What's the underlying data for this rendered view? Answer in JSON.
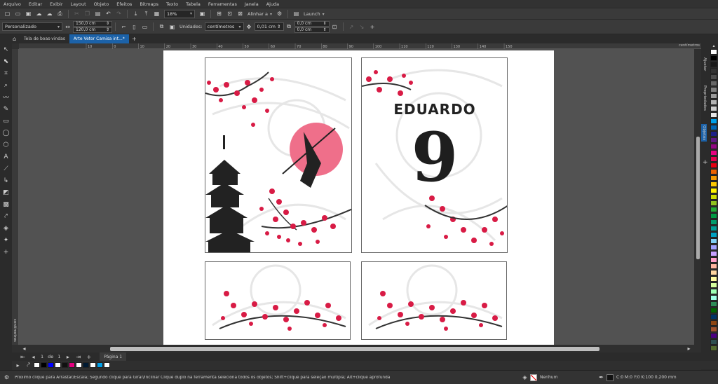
{
  "menu": [
    "Arquivo",
    "Editar",
    "Exibir",
    "Layout",
    "Objeto",
    "Efeitos",
    "Bitmaps",
    "Texto",
    "Tabela",
    "Ferramentas",
    "Janela",
    "Ajuda"
  ],
  "toolbar": {
    "zoom": "18%",
    "align_label": "Alinhar a",
    "launch_label": "Launch"
  },
  "propbar": {
    "preset": "Personalizado",
    "width": "150,0 cm",
    "height": "120,0 cm",
    "units_label": "Unidades:",
    "units": "centímetros",
    "nudge": "0,01 cm",
    "dup_x": "0,0 cm",
    "dup_y": "0,0 cm"
  },
  "tabs": [
    {
      "label": "Tela de boas-vindas"
    },
    {
      "label": "Arte Vetor Camisa int...*"
    }
  ],
  "ruler": {
    "ticks": [
      "10",
      "0",
      "10",
      "20",
      "30",
      "40",
      "50",
      "60",
      "70",
      "80",
      "90",
      "100",
      "110",
      "120",
      "130",
      "140",
      "150"
    ],
    "unit": "centímetros",
    "left_unit": "centímetros"
  },
  "artwork": {
    "name_text": "EDUARDO",
    "big_letter": "9"
  },
  "pagenav": {
    "current": "1",
    "of": "de",
    "total": "1",
    "page_label": "Página 1"
  },
  "docker_tabs": [
    "Ajustar",
    "Propriedades",
    "Objetos"
  ],
  "status": {
    "hint": "Próximo clique para Arrastar/Escala; Segundo clique para Girar/Inclinar Clique duplo na ferramenta seleciona todos os objetos; Shift+clique para seleção múltipla; Alt+clique aprofunda",
    "fill_label": "Nenhum",
    "outline": "C:0 M:0 Y:0 K:100 0,200 mm"
  },
  "palette_colors": [
    "#ffffff",
    "#000000",
    "#1a1a1a",
    "#333333",
    "#4d4d4d",
    "#666666",
    "#808080",
    "#999999",
    "#b3b3b3",
    "#cccccc",
    "#e6e6e6",
    "#00a0e9",
    "#0068b7",
    "#1d2088",
    "#601986",
    "#920783",
    "#e4007f",
    "#e5004f",
    "#e60012",
    "#eb6100",
    "#f39800",
    "#fcc800",
    "#fff100",
    "#cfdb00",
    "#8fc31f",
    "#22ac38",
    "#009944",
    "#009b6b",
    "#009e96",
    "#00a0c1",
    "#7ecef4",
    "#a0a0ff",
    "#c8a0ff",
    "#ff9ec8",
    "#ffb4a0",
    "#ffd6a0",
    "#fffaa0",
    "#d6ff9e",
    "#9effb4",
    "#9effe6",
    "#2e8b57",
    "#006400",
    "#003366",
    "#8b4513",
    "#a0522d",
    "#4b0082",
    "#2f4f4f",
    "#556b2f"
  ],
  "doc_palette": [
    "#ffffff",
    "#000000",
    "#0000ff",
    "#ffffff",
    "#111111",
    "#e4007f",
    "#ffffff",
    "#001a33",
    "#ffffff",
    "#00a0e9",
    "#ffffff"
  ]
}
